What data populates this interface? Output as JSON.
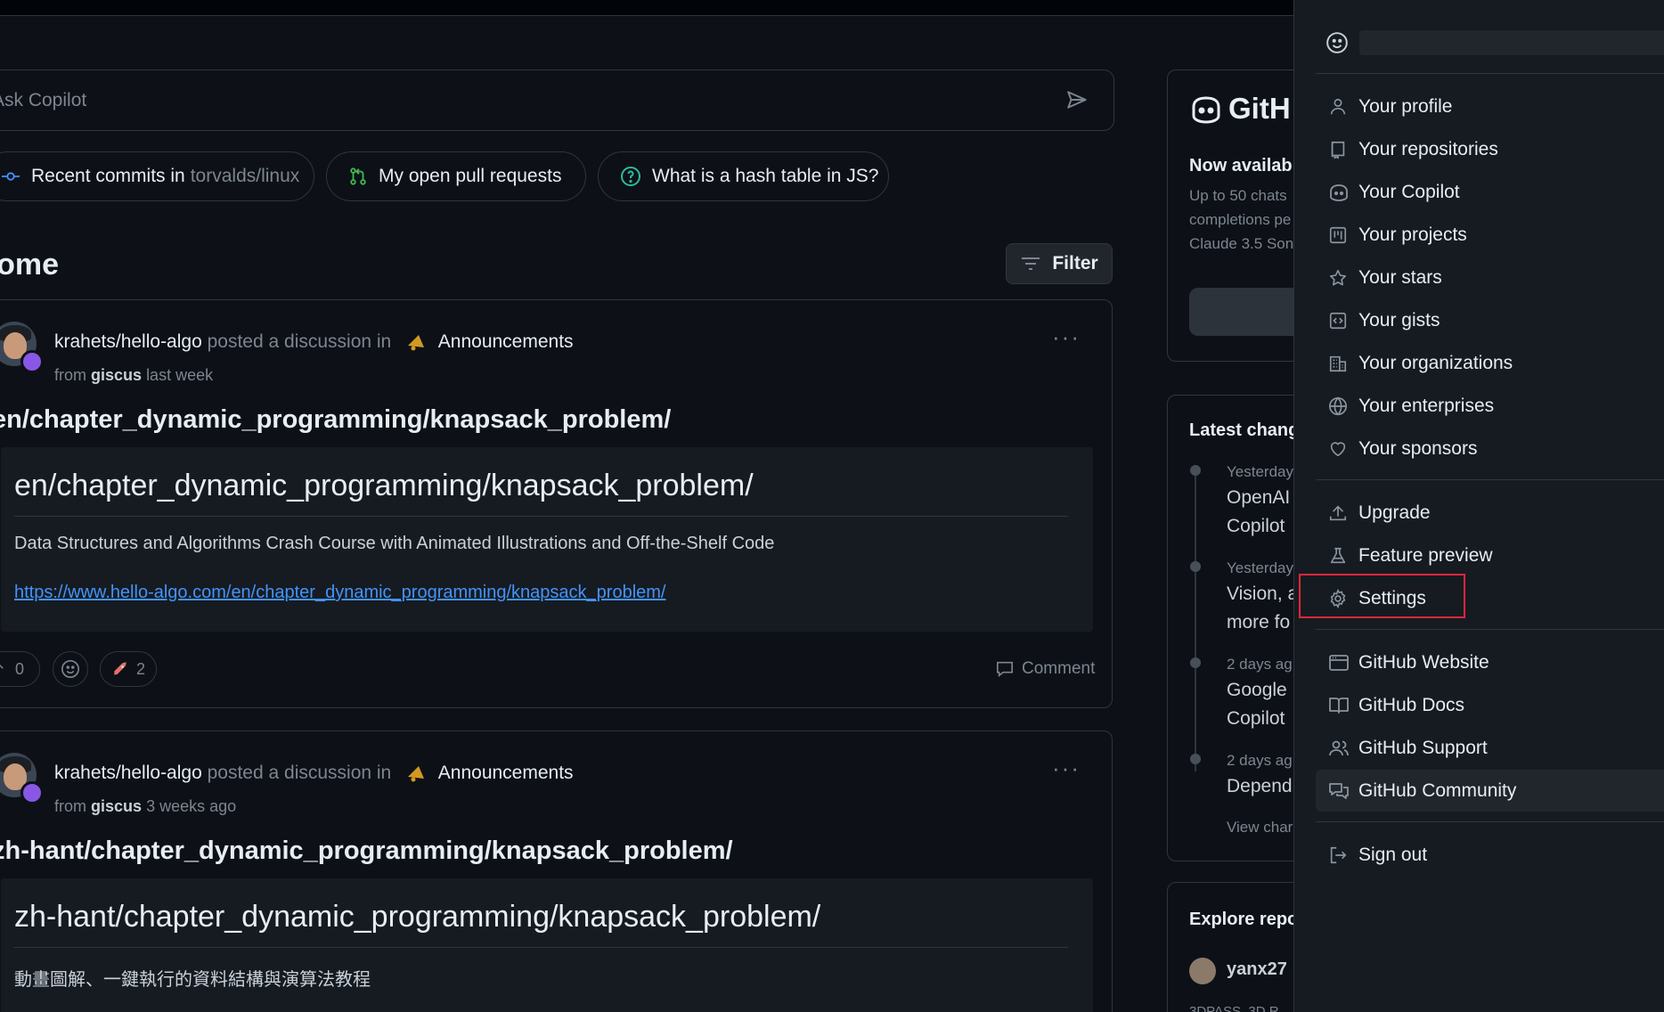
{
  "copilot": {
    "placeholder": "Ask Copilot",
    "chips": [
      {
        "label": "Recent commits in",
        "muted": "torvalds/linux"
      },
      {
        "label": "My open pull requests"
      },
      {
        "label": "What is a hash table in JS?"
      }
    ]
  },
  "feed": {
    "title": "Home",
    "filter_label": "Filter",
    "posts": [
      {
        "repo": "krahets/hello-algo",
        "action": "posted a discussion in",
        "category": "Announcements",
        "from_word": "from",
        "from_user": "giscus",
        "when": "last week",
        "title": "en/chapter_dynamic_programming/knapsack_problem/",
        "inner_heading": "en/chapter_dynamic_programming/knapsack_problem/",
        "description": "Data Structures and Algorithms Crash Course with Animated Illustrations and Off-the-Shelf Code",
        "link": "https://www.hello-algo.com/en/chapter_dynamic_programming/knapsack_problem/",
        "upvotes": "0",
        "rocket_count": "2",
        "comment_label": "Comment"
      },
      {
        "repo": "krahets/hello-algo",
        "action": "posted a discussion in",
        "category": "Announcements",
        "from_word": "from",
        "from_user": "giscus",
        "when": "3 weeks ago",
        "title": "zh-hant/chapter_dynamic_programming/knapsack_problem/",
        "inner_heading": "zh-hant/chapter_dynamic_programming/knapsack_problem/",
        "description": "動畫圖解、一鍵執行的資料結構與演算法教程"
      }
    ]
  },
  "sidebar": {
    "promo": {
      "brand": "GitH",
      "now_available": "Now availabl",
      "lines": [
        "Up to 50 chats",
        "completions pe",
        "Claude 3.5 Son"
      ]
    },
    "changelog": {
      "title": "Latest chang",
      "entries": [
        {
          "when": "Yesterday",
          "lines": [
            "OpenAI",
            "Copilot"
          ]
        },
        {
          "when": "Yesterday",
          "lines": [
            "Vision, a",
            "more fo"
          ]
        },
        {
          "when": "2 days ag",
          "lines": [
            "Google",
            "Copilot"
          ]
        },
        {
          "when": "2 days ag",
          "lines": [
            "Depend"
          ]
        }
      ],
      "view_all": "View char"
    },
    "explore": {
      "title": "Explore repo",
      "user": "yanx27",
      "sub": "3DPASS, 3D R"
    }
  },
  "user_menu": {
    "items_group1": [
      {
        "label": "Your profile",
        "icon": "person-icon"
      },
      {
        "label": "Your repositories",
        "icon": "repo-icon"
      },
      {
        "label": "Your Copilot",
        "icon": "copilot-icon"
      },
      {
        "label": "Your projects",
        "icon": "project-icon"
      },
      {
        "label": "Your stars",
        "icon": "star-icon"
      },
      {
        "label": "Your gists",
        "icon": "code-square-icon"
      },
      {
        "label": "Your organizations",
        "icon": "organization-icon"
      },
      {
        "label": "Your enterprises",
        "icon": "globe-icon"
      },
      {
        "label": "Your sponsors",
        "icon": "heart-icon"
      }
    ],
    "items_group2": [
      {
        "label": "Upgrade",
        "icon": "upload-icon"
      },
      {
        "label": "Feature preview",
        "icon": "beaker-icon"
      },
      {
        "label": "Settings",
        "icon": "gear-icon"
      }
    ],
    "items_group3": [
      {
        "label": "GitHub Website",
        "icon": "browser-icon"
      },
      {
        "label": "GitHub Docs",
        "icon": "book-icon"
      },
      {
        "label": "GitHub Support",
        "icon": "people-icon"
      },
      {
        "label": "GitHub Community",
        "icon": "comment-discussion-icon"
      }
    ],
    "sign_out": {
      "label": "Sign out",
      "icon": "sign-out-icon"
    }
  }
}
